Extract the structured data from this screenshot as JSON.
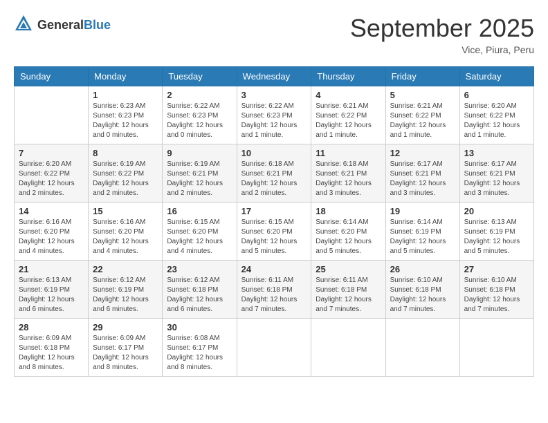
{
  "header": {
    "logo_general": "General",
    "logo_blue": "Blue",
    "title": "September 2025",
    "subtitle": "Vice, Piura, Peru"
  },
  "days_of_week": [
    "Sunday",
    "Monday",
    "Tuesday",
    "Wednesday",
    "Thursday",
    "Friday",
    "Saturday"
  ],
  "weeks": [
    [
      {
        "day": "",
        "info": ""
      },
      {
        "day": "1",
        "info": "Sunrise: 6:23 AM\nSunset: 6:23 PM\nDaylight: 12 hours\nand 0 minutes."
      },
      {
        "day": "2",
        "info": "Sunrise: 6:22 AM\nSunset: 6:23 PM\nDaylight: 12 hours\nand 0 minutes."
      },
      {
        "day": "3",
        "info": "Sunrise: 6:22 AM\nSunset: 6:23 PM\nDaylight: 12 hours\nand 1 minute."
      },
      {
        "day": "4",
        "info": "Sunrise: 6:21 AM\nSunset: 6:22 PM\nDaylight: 12 hours\nand 1 minute."
      },
      {
        "day": "5",
        "info": "Sunrise: 6:21 AM\nSunset: 6:22 PM\nDaylight: 12 hours\nand 1 minute."
      },
      {
        "day": "6",
        "info": "Sunrise: 6:20 AM\nSunset: 6:22 PM\nDaylight: 12 hours\nand 1 minute."
      }
    ],
    [
      {
        "day": "7",
        "info": "Sunrise: 6:20 AM\nSunset: 6:22 PM\nDaylight: 12 hours\nand 2 minutes."
      },
      {
        "day": "8",
        "info": "Sunrise: 6:19 AM\nSunset: 6:22 PM\nDaylight: 12 hours\nand 2 minutes."
      },
      {
        "day": "9",
        "info": "Sunrise: 6:19 AM\nSunset: 6:21 PM\nDaylight: 12 hours\nand 2 minutes."
      },
      {
        "day": "10",
        "info": "Sunrise: 6:18 AM\nSunset: 6:21 PM\nDaylight: 12 hours\nand 2 minutes."
      },
      {
        "day": "11",
        "info": "Sunrise: 6:18 AM\nSunset: 6:21 PM\nDaylight: 12 hours\nand 3 minutes."
      },
      {
        "day": "12",
        "info": "Sunrise: 6:17 AM\nSunset: 6:21 PM\nDaylight: 12 hours\nand 3 minutes."
      },
      {
        "day": "13",
        "info": "Sunrise: 6:17 AM\nSunset: 6:21 PM\nDaylight: 12 hours\nand 3 minutes."
      }
    ],
    [
      {
        "day": "14",
        "info": "Sunrise: 6:16 AM\nSunset: 6:20 PM\nDaylight: 12 hours\nand 4 minutes."
      },
      {
        "day": "15",
        "info": "Sunrise: 6:16 AM\nSunset: 6:20 PM\nDaylight: 12 hours\nand 4 minutes."
      },
      {
        "day": "16",
        "info": "Sunrise: 6:15 AM\nSunset: 6:20 PM\nDaylight: 12 hours\nand 4 minutes."
      },
      {
        "day": "17",
        "info": "Sunrise: 6:15 AM\nSunset: 6:20 PM\nDaylight: 12 hours\nand 5 minutes."
      },
      {
        "day": "18",
        "info": "Sunrise: 6:14 AM\nSunset: 6:20 PM\nDaylight: 12 hours\nand 5 minutes."
      },
      {
        "day": "19",
        "info": "Sunrise: 6:14 AM\nSunset: 6:19 PM\nDaylight: 12 hours\nand 5 minutes."
      },
      {
        "day": "20",
        "info": "Sunrise: 6:13 AM\nSunset: 6:19 PM\nDaylight: 12 hours\nand 5 minutes."
      }
    ],
    [
      {
        "day": "21",
        "info": "Sunrise: 6:13 AM\nSunset: 6:19 PM\nDaylight: 12 hours\nand 6 minutes."
      },
      {
        "day": "22",
        "info": "Sunrise: 6:12 AM\nSunset: 6:19 PM\nDaylight: 12 hours\nand 6 minutes."
      },
      {
        "day": "23",
        "info": "Sunrise: 6:12 AM\nSunset: 6:18 PM\nDaylight: 12 hours\nand 6 minutes."
      },
      {
        "day": "24",
        "info": "Sunrise: 6:11 AM\nSunset: 6:18 PM\nDaylight: 12 hours\nand 7 minutes."
      },
      {
        "day": "25",
        "info": "Sunrise: 6:11 AM\nSunset: 6:18 PM\nDaylight: 12 hours\nand 7 minutes."
      },
      {
        "day": "26",
        "info": "Sunrise: 6:10 AM\nSunset: 6:18 PM\nDaylight: 12 hours\nand 7 minutes."
      },
      {
        "day": "27",
        "info": "Sunrise: 6:10 AM\nSunset: 6:18 PM\nDaylight: 12 hours\nand 7 minutes."
      }
    ],
    [
      {
        "day": "28",
        "info": "Sunrise: 6:09 AM\nSunset: 6:18 PM\nDaylight: 12 hours\nand 8 minutes."
      },
      {
        "day": "29",
        "info": "Sunrise: 6:09 AM\nSunset: 6:17 PM\nDaylight: 12 hours\nand 8 minutes."
      },
      {
        "day": "30",
        "info": "Sunrise: 6:08 AM\nSunset: 6:17 PM\nDaylight: 12 hours\nand 8 minutes."
      },
      {
        "day": "",
        "info": ""
      },
      {
        "day": "",
        "info": ""
      },
      {
        "day": "",
        "info": ""
      },
      {
        "day": "",
        "info": ""
      }
    ]
  ]
}
